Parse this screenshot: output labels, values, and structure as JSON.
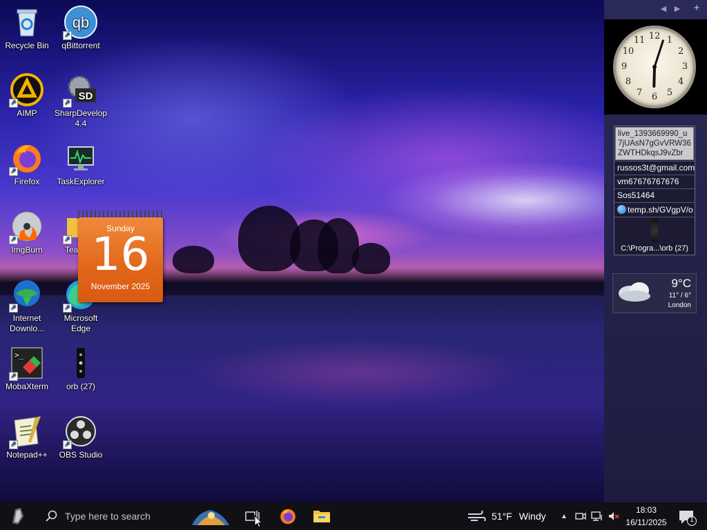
{
  "desktop": {
    "icons": [
      {
        "label": "Recycle Bin",
        "icon": "recycle-bin-icon"
      },
      {
        "label": "qBittorrent",
        "icon": "qbittorrent-icon"
      },
      {
        "label": "AIMP",
        "icon": "aimp-icon"
      },
      {
        "label": "SharpDevelop 4.4",
        "icon": "sharpdevelop-icon"
      },
      {
        "label": "Firefox",
        "icon": "firefox-icon"
      },
      {
        "label": "TaskExplorer",
        "icon": "taskexplorer-icon"
      },
      {
        "label": "ImgBurn",
        "icon": "imgburn-icon"
      },
      {
        "label": "Tea",
        "icon": "folder-icon"
      },
      {
        "label": "Internet Downlo...",
        "icon": "internet-download-manager-icon"
      },
      {
        "label": "Microsoft Edge",
        "icon": "edge-icon"
      },
      {
        "label": "MobaXterm",
        "icon": "mobaxterm-icon"
      },
      {
        "label": "orb (27)",
        "icon": "orb-icon"
      },
      {
        "label": "Notepad++",
        "icon": "notepadpp-icon"
      },
      {
        "label": "OBS Studio",
        "icon": "obs-icon"
      }
    ],
    "shortcut_arrow": "↗"
  },
  "calendar": {
    "day_name": "Sunday",
    "day": "16",
    "month_year": "November 2025"
  },
  "sidebar": {
    "nav_prev": "◀",
    "nav_next": "▶",
    "add": "+",
    "clock": {
      "numbers": [
        "12",
        "1",
        "2",
        "3",
        "4",
        "5",
        "6",
        "7",
        "8",
        "9",
        "10",
        "11"
      ],
      "time": "18:03"
    },
    "notes": {
      "selected": "live_1393669990_u7jUAsN7gGvVRW36ZWTHDkqsJ9vZbr",
      "rows": [
        "russos3t@gmail.com",
        "vm67676767676",
        "Sos51464",
        "temp.sh/GVgpV/o"
      ],
      "orb_label": "C:\\Progra...\\orb (27)"
    },
    "weather": {
      "temp": "9°C",
      "range": "11° / 6°",
      "city": "London"
    }
  },
  "taskbar": {
    "search_placeholder": "Type here to search",
    "weather": {
      "temp": "51°F",
      "condition": "Windy"
    },
    "time": "18:03",
    "date": "16/11/2025",
    "notification_count": "1",
    "tray_up": "▲"
  }
}
